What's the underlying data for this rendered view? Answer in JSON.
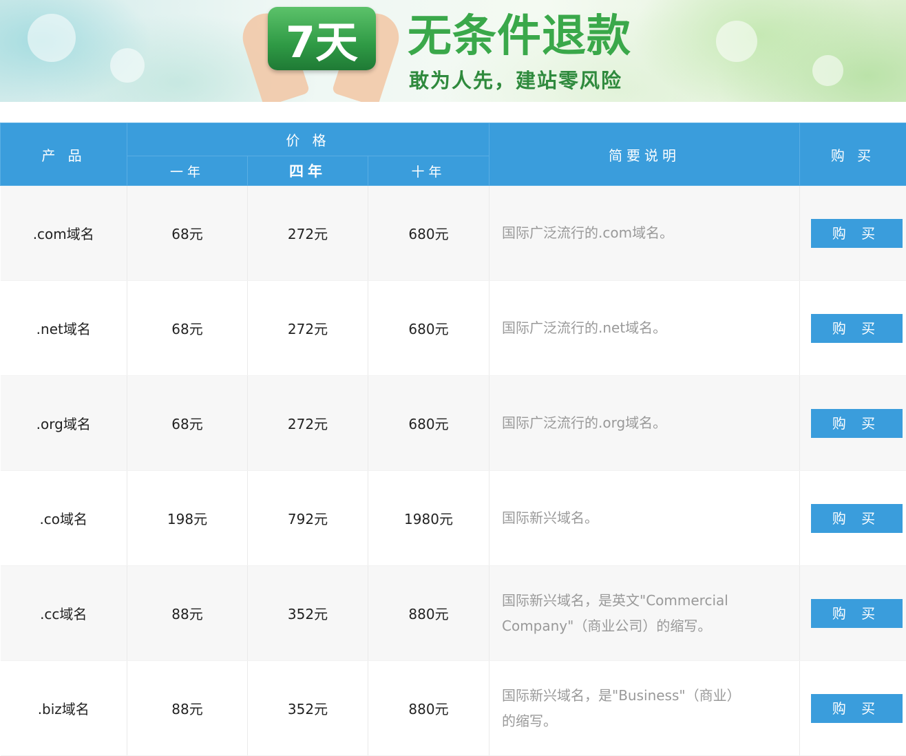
{
  "banner": {
    "badge": "7天",
    "title": "无条件退款",
    "subtitle": "敢为人先，建站零风险"
  },
  "table": {
    "headers": {
      "product": "产 品",
      "price": "价 格",
      "description": "简要说明",
      "buy": "购 买",
      "year1": "一年",
      "year4": "四年",
      "year10": "十年"
    },
    "rows": [
      {
        "product": ".com域名",
        "y1": "68元",
        "y4": "272元",
        "y10": "680元",
        "desc": "国际广泛流行的.com域名。",
        "buy": "购 买"
      },
      {
        "product": ".net域名",
        "y1": "68元",
        "y4": "272元",
        "y10": "680元",
        "desc": "国际广泛流行的.net域名。",
        "buy": "购 买"
      },
      {
        "product": ".org域名",
        "y1": "68元",
        "y4": "272元",
        "y10": "680元",
        "desc": "国际广泛流行的.org域名。",
        "buy": "购 买"
      },
      {
        "product": ".co域名",
        "y1": "198元",
        "y4": "792元",
        "y10": "1980元",
        "desc": "国际新兴域名。",
        "buy": "购 买"
      },
      {
        "product": ".cc域名",
        "y1": "88元",
        "y4": "352元",
        "y10": "880元",
        "desc": "国际新兴域名，是英文\"Commercial Company\"（商业公司）的缩写。",
        "buy": "购 买"
      },
      {
        "product": ".biz域名",
        "y1": "88元",
        "y4": "352元",
        "y10": "880元",
        "desc": "国际新兴域名，是\"Business\"（商业）的缩写。",
        "buy": "购 买"
      }
    ]
  }
}
